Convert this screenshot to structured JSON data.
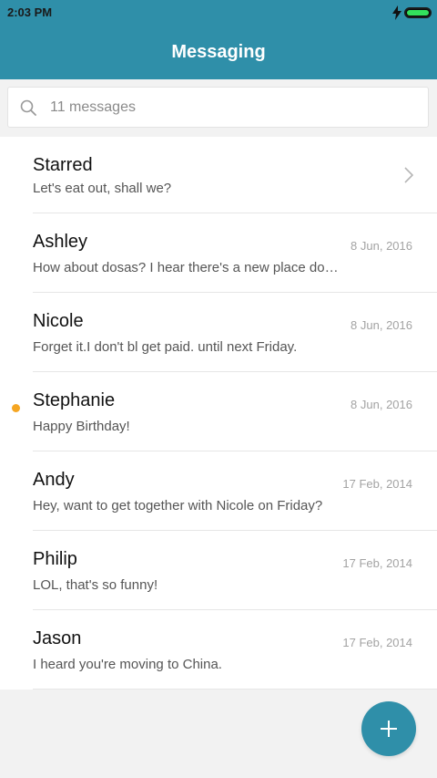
{
  "status_bar": {
    "time": "2:03 PM",
    "battery_level": 1.0
  },
  "header": {
    "title": "Messaging"
  },
  "search": {
    "placeholder": "11 messages",
    "icon": "search-icon"
  },
  "conversations": [
    {
      "name": "Starred",
      "preview": "Let's eat out, shall we?",
      "date": "",
      "has_chevron": true,
      "unread": false
    },
    {
      "name": "Ashley",
      "preview": "How about dosas? I hear there's a new place do…",
      "date": "8 Jun, 2016",
      "unread": false
    },
    {
      "name": "Nicole",
      "preview": "Forget it.I don't bl get paid. until next Friday.",
      "date": "8 Jun, 2016",
      "unread": false
    },
    {
      "name": "Stephanie",
      "preview": "Happy Birthday!",
      "date": "8 Jun, 2016",
      "unread": true
    },
    {
      "name": "Andy",
      "preview": "Hey, want to get together with Nicole on Friday?",
      "date": "17 Feb, 2014",
      "unread": false
    },
    {
      "name": "Philip",
      "preview": "LOL, that's so funny!",
      "date": "17 Feb, 2014",
      "unread": false
    },
    {
      "name": "Jason",
      "preview": "I heard you're moving to China.",
      "date": "17 Feb, 2014",
      "unread": false
    }
  ],
  "fab": {
    "icon": "plus-icon"
  },
  "colors": {
    "accent": "#2f8fa9",
    "unread_dot": "#f5a623",
    "battery": "#33e05c"
  }
}
